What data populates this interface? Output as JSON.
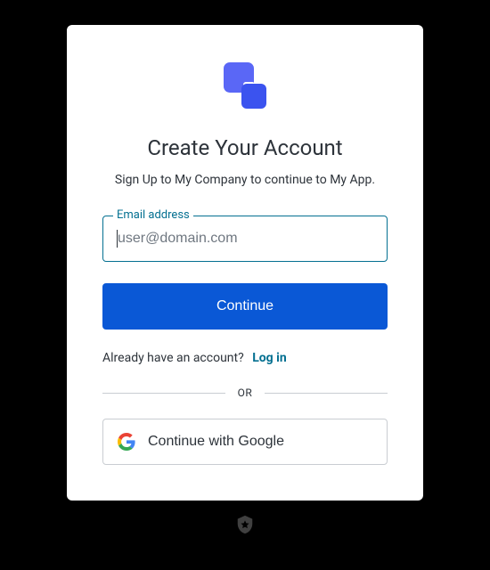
{
  "card": {
    "title": "Create Your Account",
    "subtitle": "Sign Up to My Company to continue to My App.",
    "email_field": {
      "label": "Email address",
      "placeholder": "user@domain.com",
      "value": ""
    },
    "continue_label": "Continue",
    "login_prompt": "Already have an account?",
    "login_link_label": "Log in",
    "divider_label": "OR",
    "google_button_label": "Continue with Google"
  },
  "colors": {
    "accent": "#047091",
    "primary_button": "#0a58d6",
    "logo_back": "#5a67f6",
    "logo_front": "#3b53ef"
  }
}
